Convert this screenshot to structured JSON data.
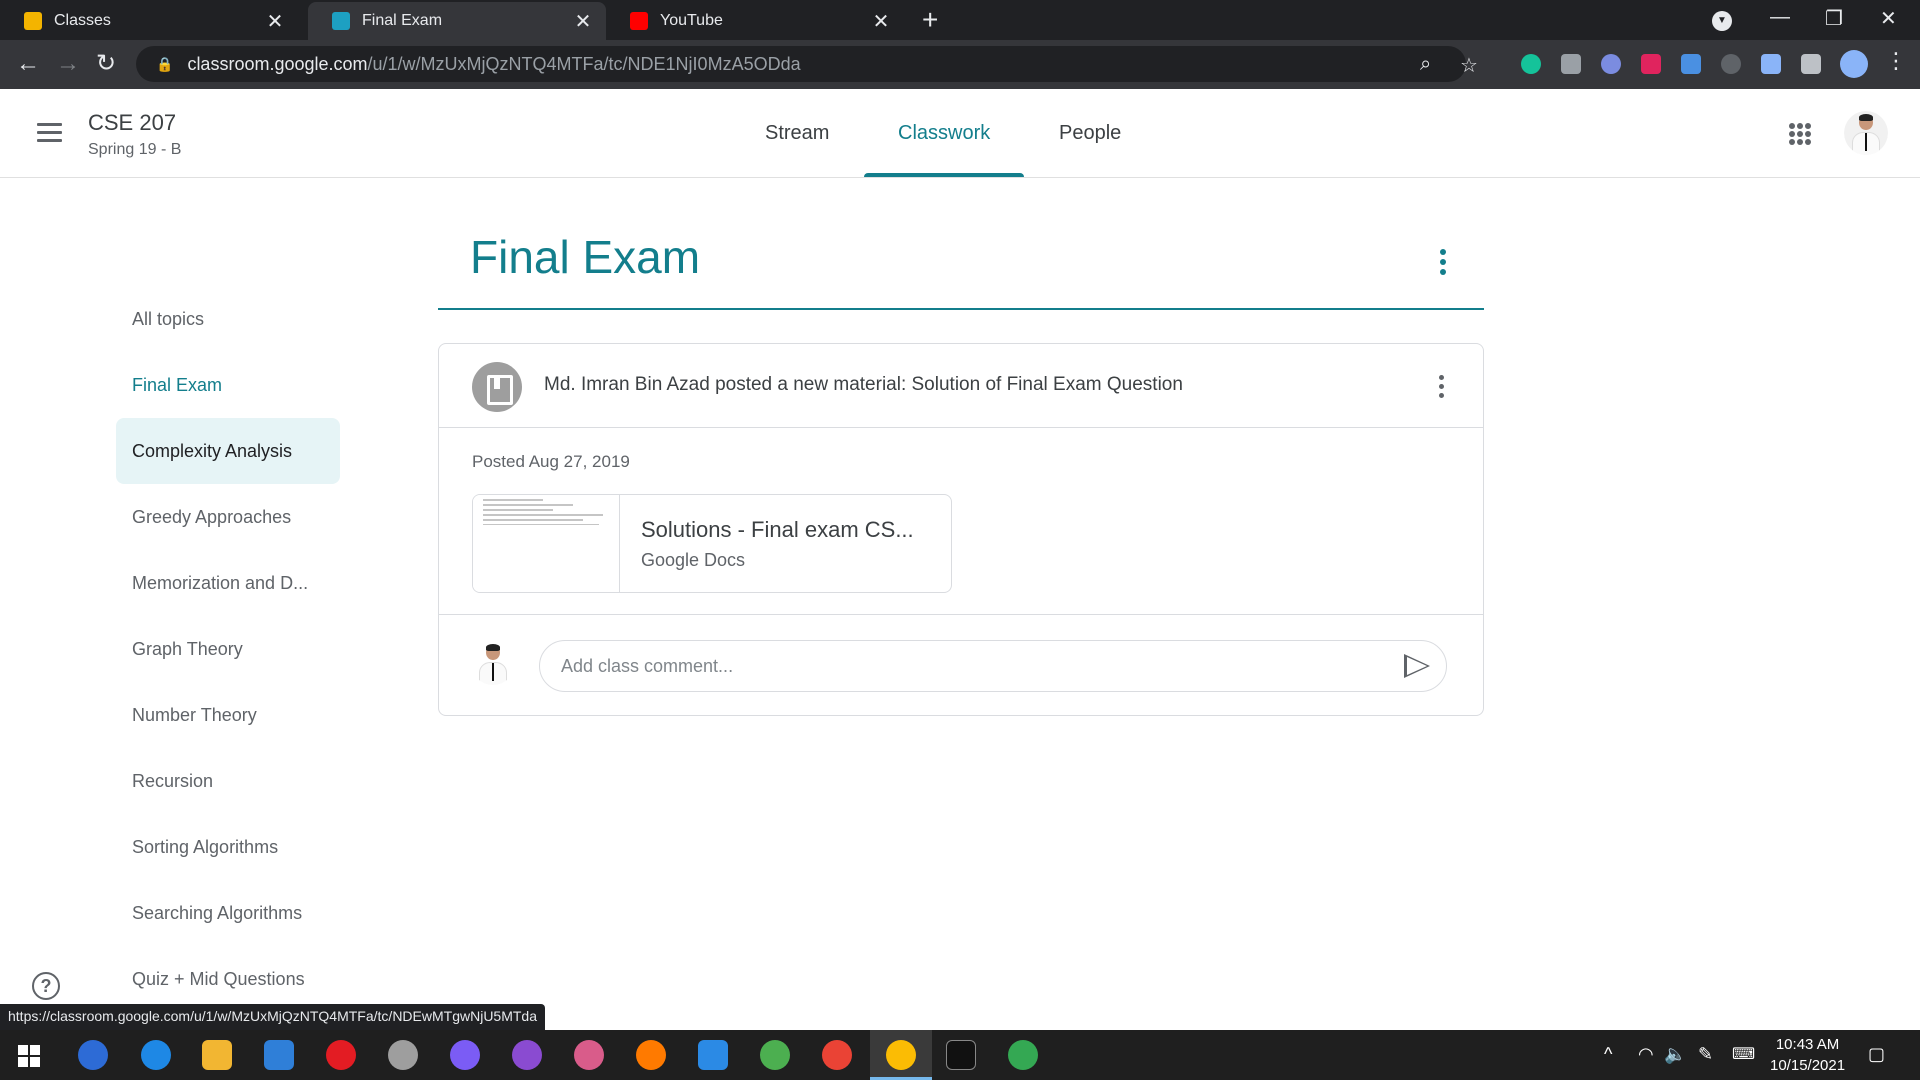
{
  "browser": {
    "tabs": [
      {
        "title": "Classes",
        "favicon_color": "#f4b400",
        "active": false
      },
      {
        "title": "Final Exam",
        "favicon_color": "#1da0c2",
        "active": true
      },
      {
        "title": "YouTube",
        "favicon_color": "#ff0000",
        "active": false
      }
    ],
    "url_host": "classroom.google.com",
    "url_path": "/u/1/w/MzUxMjQzNTQ4MTFa/tc/NDE1NjI0MzA5ODda",
    "status_url": "https://classroom.google.com/u/1/w/MzUxMjQzNTQ4MTFa/tc/NDEwMTgwNjU5MTda"
  },
  "header": {
    "class_name": "CSE 207",
    "section": "Spring 19 - B",
    "tabs": [
      {
        "label": "Stream"
      },
      {
        "label": "Classwork"
      },
      {
        "label": "People"
      }
    ],
    "active_tab": "Classwork"
  },
  "sidebar": {
    "items": [
      {
        "label": "All topics"
      },
      {
        "label": "Final Exam"
      },
      {
        "label": "Complexity Analysis"
      },
      {
        "label": "Greedy Approaches"
      },
      {
        "label": "Memorization and D..."
      },
      {
        "label": "Graph Theory"
      },
      {
        "label": "Number Theory"
      },
      {
        "label": "Recursion"
      },
      {
        "label": "Sorting Algorithms"
      },
      {
        "label": "Searching Algorithms"
      },
      {
        "label": "Quiz + Mid Questions"
      }
    ],
    "selected": "Final Exam",
    "hovered": "Complexity Analysis"
  },
  "main": {
    "topic_title": "Final Exam",
    "post": {
      "text": "Md. Imran Bin Azad posted a new material: Solution of Final Exam Question",
      "posted": "Posted Aug 27, 2019",
      "attachment_title": "Solutions - Final exam CS...",
      "attachment_type": "Google Docs",
      "comment_placeholder": "Add class comment..."
    }
  },
  "help_label": "?",
  "taskbar": {
    "time": "10:43 AM",
    "date": "10/15/2021"
  },
  "colors": {
    "accent": "#137e8c",
    "hover_bg": "#e6f4f6"
  }
}
